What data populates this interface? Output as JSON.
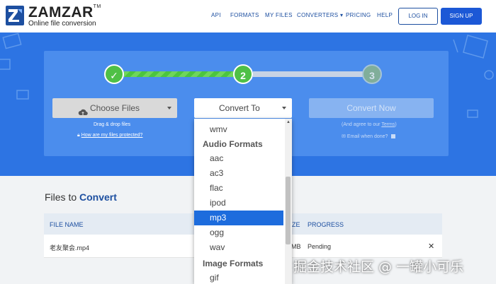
{
  "brand": {
    "name": "ZAMZAR",
    "trademark": "TM",
    "tagline": "Online file conversion"
  },
  "nav": {
    "links": [
      "API",
      "FORMATS",
      "MY FILES",
      "CONVERTERS",
      "PRICING",
      "HELP"
    ],
    "login": "LOG IN",
    "signup": "SIGN UP"
  },
  "steps": {
    "one": "✓",
    "two": "2",
    "three": "3",
    "progress_fraction": 0.5
  },
  "choose": {
    "label": "Choose Files",
    "drag_text": "Drag & drop files",
    "protected_link": "How are my files protected?"
  },
  "convert_to": {
    "label": "Convert To"
  },
  "convert_now": {
    "label": "Convert Now",
    "agree_text": "(And agree to our ",
    "terms_link": "Terms",
    "agree_close": ")",
    "email_text": "Email when done?"
  },
  "files": {
    "title_prefix": "Files to ",
    "title_highlight": "Convert",
    "headers": {
      "file_name": "FILE NAME",
      "size": "ZE",
      "progress": "PROGRESS"
    },
    "row": {
      "name": "老友聚会.mp4",
      "size": "MB",
      "status": "Pending",
      "remove": "✕"
    }
  },
  "dropdown": {
    "items": [
      {
        "label": "wmv",
        "group": false
      },
      {
        "label": "Audio Formats",
        "group": true
      },
      {
        "label": "aac",
        "group": false
      },
      {
        "label": "ac3",
        "group": false
      },
      {
        "label": "flac",
        "group": false
      },
      {
        "label": "ipod",
        "group": false
      },
      {
        "label": "mp3",
        "group": false,
        "selected": true
      },
      {
        "label": "ogg",
        "group": false
      },
      {
        "label": "wav",
        "group": false
      },
      {
        "label": "Image Formats",
        "group": true
      },
      {
        "label": "gif",
        "group": false
      }
    ]
  },
  "watermark": "掘金技术社区 @ 一罐小可乐",
  "colors": {
    "brand": "#1d4fa0",
    "hero": "#2d74e3",
    "success": "#4fc046",
    "selected": "#1d6cdd"
  }
}
